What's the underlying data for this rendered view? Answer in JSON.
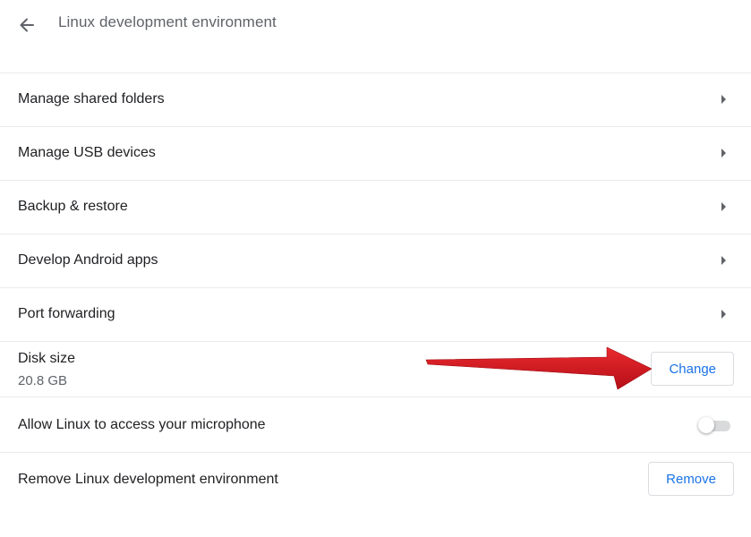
{
  "header": {
    "title": "Linux development environment"
  },
  "settings": {
    "links": [
      {
        "label": "Manage shared folders"
      },
      {
        "label": "Manage USB devices"
      },
      {
        "label": "Backup & restore"
      },
      {
        "label": "Develop Android apps"
      },
      {
        "label": "Port forwarding"
      }
    ],
    "disk": {
      "label": "Disk size",
      "value": "20.8 GB",
      "button_label": "Change"
    },
    "microphone": {
      "label": "Allow Linux to access your microphone",
      "enabled": false
    },
    "remove": {
      "label": "Remove Linux development environment",
      "button_label": "Remove"
    }
  },
  "colors": {
    "accent": "#1a73e8",
    "annotation_arrow": "#d0121b"
  }
}
